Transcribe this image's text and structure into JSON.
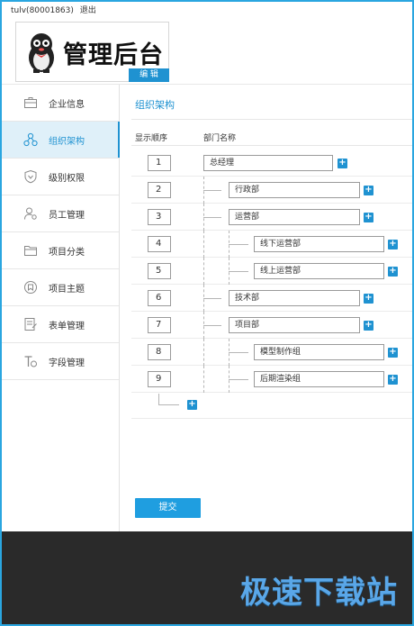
{
  "topbar": {
    "user": "tulv(80001863)",
    "logout": "退出"
  },
  "logo": {
    "text": "管理后台",
    "edit_badge": "编 辑"
  },
  "sidebar": {
    "items": [
      {
        "label": "企业信息",
        "icon": "briefcase-icon",
        "active": false
      },
      {
        "label": "组织架构",
        "icon": "org-structure-icon",
        "active": true
      },
      {
        "label": "级别权限",
        "icon": "shield-icon",
        "active": false
      },
      {
        "label": "员工管理",
        "icon": "user-settings-icon",
        "active": false
      },
      {
        "label": "项目分类",
        "icon": "folder-icon",
        "active": false
      },
      {
        "label": "项目主题",
        "icon": "theme-badge-icon",
        "active": false
      },
      {
        "label": "表单管理",
        "icon": "form-icon",
        "active": false
      },
      {
        "label": "字段管理",
        "icon": "text-field-icon",
        "active": false
      }
    ]
  },
  "main": {
    "title": "组织架构",
    "columns": {
      "order": "显示顺序",
      "dept": "部门名称"
    },
    "rows": [
      {
        "order": "1",
        "name": "总经理",
        "level": 0
      },
      {
        "order": "2",
        "name": "行政部",
        "level": 1
      },
      {
        "order": "3",
        "name": "运营部",
        "level": 1
      },
      {
        "order": "4",
        "name": "线下运营部",
        "level": 2
      },
      {
        "order": "5",
        "name": "线上运营部",
        "level": 2
      },
      {
        "order": "6",
        "name": "技术部",
        "level": 1
      },
      {
        "order": "7",
        "name": "项目部",
        "level": 1
      },
      {
        "order": "8",
        "name": "模型制作组",
        "level": 2
      },
      {
        "order": "9",
        "name": "后期渲染组",
        "level": 2
      }
    ],
    "add_symbol": "+",
    "submit": "提交"
  },
  "watermark": "极速下载站",
  "colors": {
    "accent": "#1f92d1",
    "footer": "#2a2a2a",
    "watermark": "#5aa7e8"
  }
}
